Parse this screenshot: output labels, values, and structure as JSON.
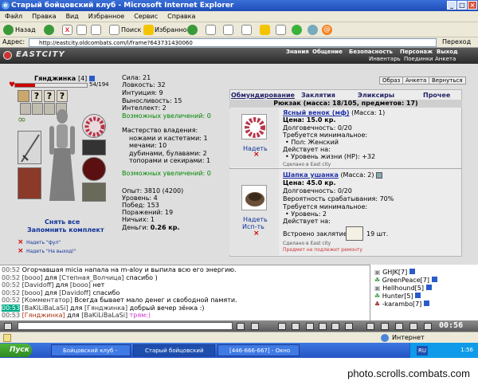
{
  "window": {
    "title": "Старый бойцовский клуб - Microsoft Internet Explorer"
  },
  "menu": [
    "Файл",
    "Правка",
    "Вид",
    "Избранное",
    "Сервис",
    "Справка"
  ],
  "toolbar": {
    "back": "Назад",
    "search": "Поиск",
    "favorites": "Избранное"
  },
  "address": {
    "label": "Адрес:",
    "url": "http://eastcity.oldcombats.com/l/frame?643731430060",
    "go": "Переход"
  },
  "gamenav": {
    "logo": "EASTCITY",
    "top": [
      "Знания",
      "Общение",
      "Безопасность",
      "Персонаж",
      "Выход"
    ],
    "bottom": [
      "Инвентарь",
      "Поединки",
      "Анкета"
    ]
  },
  "character": {
    "name": "Гянджинка",
    "level": "[4]",
    "hp": "54/194",
    "hp_fraction": 0.278,
    "put_all": "Снять все",
    "remember_set": "Запомнить комплект",
    "wear_ful": "Надеть \"фул\"",
    "wear_outing": "Надеть \"На выход!\""
  },
  "stats": [
    "Сила: 21",
    "Ловкость: 32",
    "Интуиция: 9",
    "Выносливость: 15",
    "Интеллект: 2",
    "Возможных увеличений: 0"
  ],
  "mastery": {
    "title": "Мастерство владения:",
    "lines": [
      "ножами и кастетами: 1",
      "мечами: 10",
      "дубинами, булавами: 2",
      "топорами и секирами: 1"
    ],
    "increase": "Возможных увеличений: 0"
  },
  "info": [
    "Опыт: 3810 (4200)",
    "Уровень: 4",
    "Побед: 153",
    "Поражений: 19",
    "Ничьих: 1"
  ],
  "money": {
    "label": "Деньги:",
    "value": "0.26 кр."
  },
  "header_buttons": [
    "Образ",
    "Анкета",
    "Вернуться"
  ],
  "inventory": {
    "tabs": [
      "Обмундирование",
      "Заклятия",
      "Эликсиры",
      "Прочее"
    ],
    "backpack": "Рюкзак (масса: 18/105, предметов: 17)",
    "items": [
      {
        "name": "Ясный венок (мф)",
        "mass": "(Масса: 1)",
        "price": "Цена: 15.0 кр.",
        "durability": "Долговечность: 0/20",
        "req_title": "Требуется минимальное:",
        "req": "• Пол: Женский",
        "acts_title": "Действует на:",
        "acts": "• Уровень жизни (HP): +32",
        "made": "Сделано в East city",
        "action": "Надеть"
      },
      {
        "name": "Шапка ушанка",
        "mass": "(Масса: 2)",
        "price": "Цена: 45.0 кр.",
        "durability": "Долговечность: 0/20",
        "chance": "Вероятность срабатывания: 70%",
        "req_title": "Требуется минимальное:",
        "req": "• Уровень: 2",
        "acts_title": "Действует на:",
        "spell": "Встроено заклятие",
        "spell_count": "19 шт.",
        "made": "Сделано в East city",
        "note": "Предмет не подлежит ремонту",
        "action": "Надеть",
        "action2": "Исп-ть"
      }
    ]
  },
  "chat": [
    {
      "time": "00:52",
      "text": " Огорчавшая micia напала на m-aloy и выпила всю его энергию.",
      "hl": false
    },
    {
      "time": "00:52",
      "nick": "[booo]",
      "mid": " для ",
      "to": "[Степная_Волчица]",
      "text": " спасибо )",
      "hl": false
    },
    {
      "time": "00:52",
      "nick": "[Davidoff]",
      "mid": " для ",
      "to": "[booo]",
      "text": " нет",
      "hl": false
    },
    {
      "time": "00:52",
      "nick": "[booo]",
      "mid": " для ",
      "to": "[Davidoff]",
      "text": " спасибо",
      "hl": false
    },
    {
      "time": "00:52",
      "nick": "[Комментатор]",
      "mid": " ",
      "to": "",
      "text": "Всегда бывает мало денег и свободной памяти.",
      "hl": false
    },
    {
      "time": "00:53",
      "nick": "[BaKiLiBaLaSi]",
      "mid": " для ",
      "to": "[Гянджинка]",
      "text": " добрый вечер зёнка :)",
      "hl": true
    },
    {
      "time": "00:53",
      "nick": "[Гянджинка]",
      "mid": " для ",
      "to": "[BaKiLiBaLaSi]",
      "text": " трям:)",
      "hl": false
    }
  ],
  "online": [
    "GHJK[7]",
    "GreenPeace[7]",
    "Hellhound[5]",
    "Hunter[5]",
    "-karambo[7]"
  ],
  "chatbar": {
    "clock": "00:56"
  },
  "status": {
    "zone": "Интернет"
  },
  "taskbar": {
    "start": "Пуск",
    "tasks": [
      "Бойцовский клуб - Micr...",
      "Старый бойцовский клуб...",
      "[446-666-667] - Окно со..."
    ],
    "lang": "RU",
    "time": "1:56"
  },
  "footer": {
    "site": "photo.scrolls.combats.com"
  }
}
